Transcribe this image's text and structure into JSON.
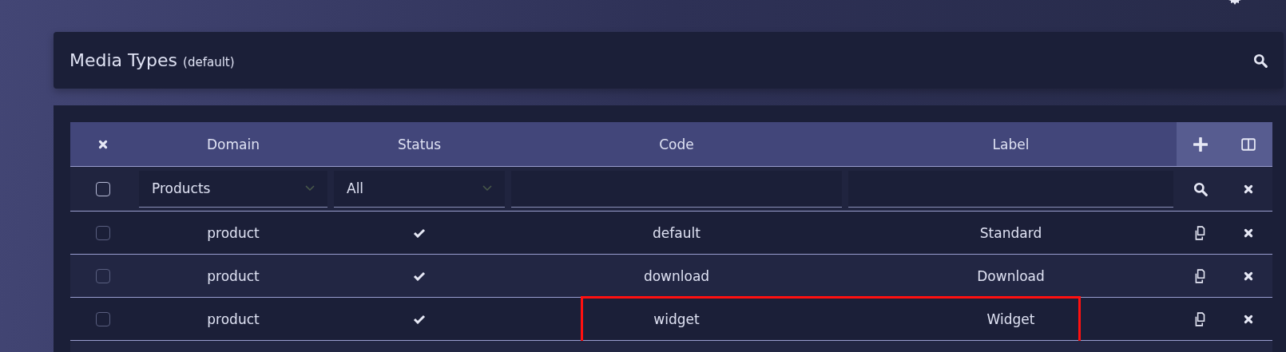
{
  "header": {
    "title": "Media Types",
    "subtitle": "(default)"
  },
  "table": {
    "columns": [
      "Domain",
      "Status",
      "Code",
      "Label"
    ],
    "filters": {
      "checked": false,
      "domain": "Products",
      "status": "All"
    },
    "rows": [
      {
        "checked": false,
        "domain": "product",
        "status": true,
        "code": "default",
        "label": "Standard",
        "highlighted": false
      },
      {
        "checked": false,
        "domain": "product",
        "status": true,
        "code": "download",
        "label": "Download",
        "highlighted": false
      },
      {
        "checked": false,
        "domain": "product",
        "status": true,
        "code": "widget",
        "label": "Widget",
        "highlighted": true
      }
    ]
  }
}
